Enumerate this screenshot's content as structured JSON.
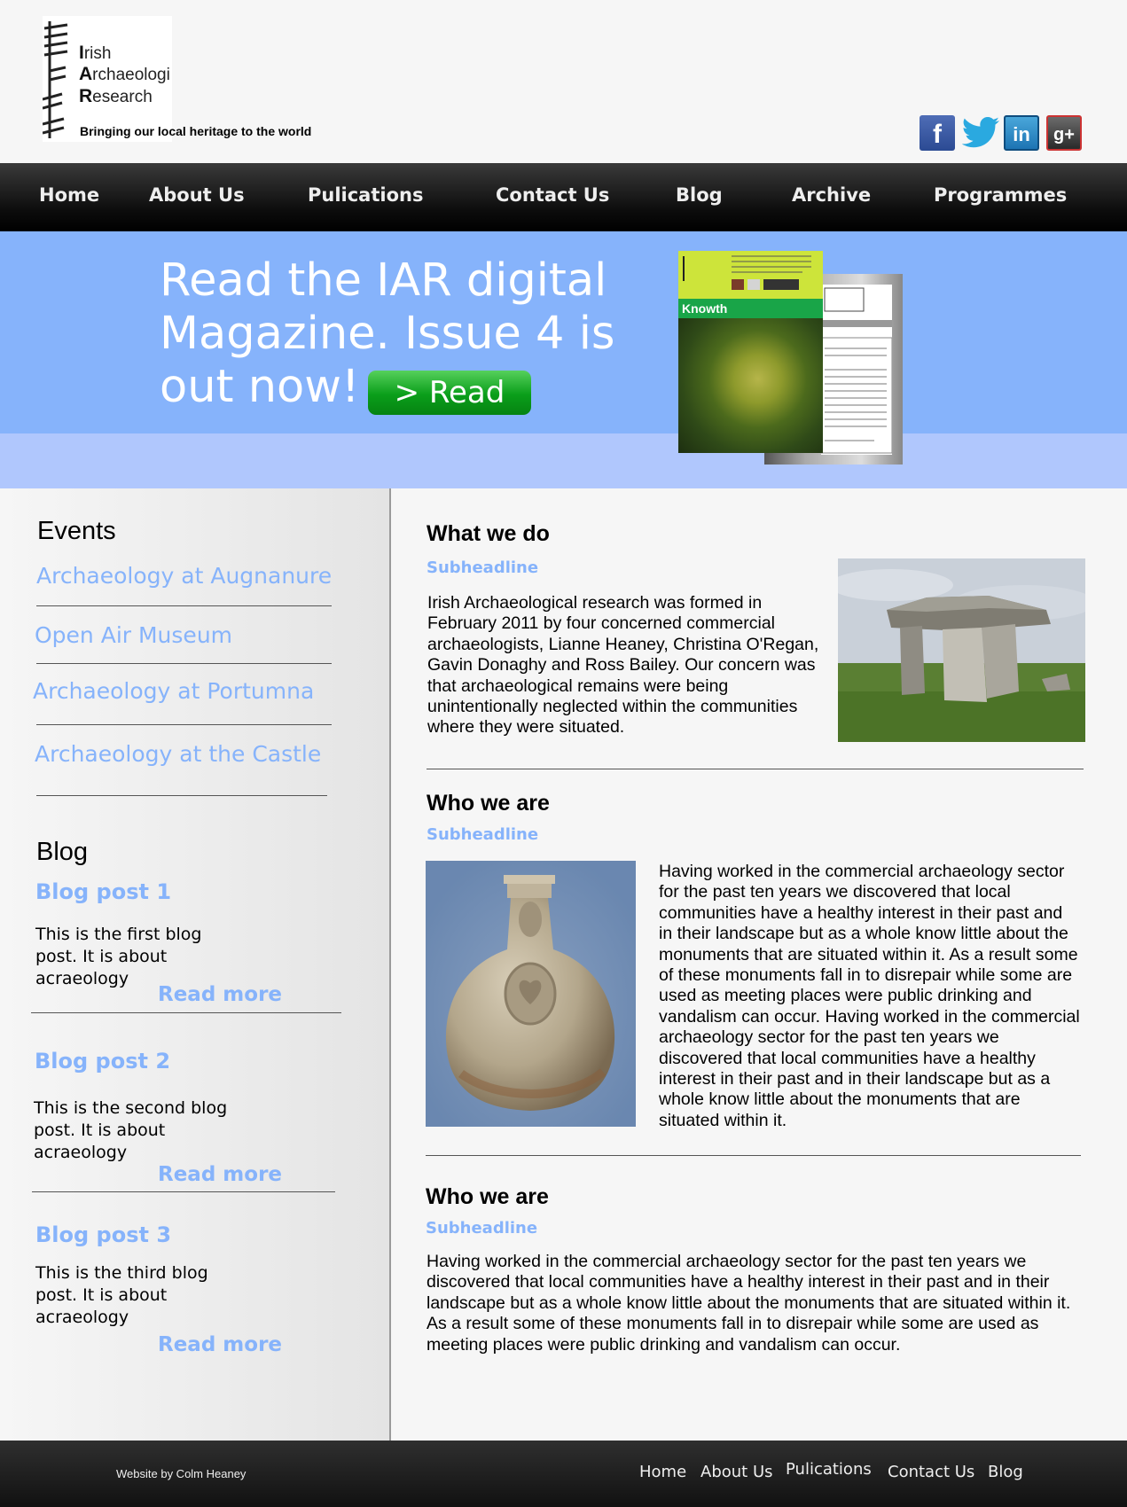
{
  "header": {
    "logo_lines": [
      {
        "initial": "I",
        "rest": "rish"
      },
      {
        "initial": "A",
        "rest": "rchaeologi"
      },
      {
        "initial": "R",
        "rest": "esearch"
      }
    ],
    "tagline": "Bringing our local heritage to the world",
    "social": [
      {
        "label": "f",
        "icon": "facebook-icon"
      },
      {
        "label": "",
        "icon": "twitter-icon"
      },
      {
        "label": "in",
        "icon": "linkedin-icon"
      },
      {
        "label": "g+",
        "icon": "google-plus-icon"
      }
    ]
  },
  "nav": {
    "items": [
      "Home",
      "About Us",
      "Pulications",
      "Contact Us",
      "Blog",
      "Archive",
      "Programmes"
    ]
  },
  "banner": {
    "line1": "Read the IAR digital",
    "line2": "Magazine. Issue 4 is",
    "line3": "out now!",
    "button": "> Read",
    "magazine_strip": "Knowth"
  },
  "sidebar": {
    "events_heading": "Events",
    "events": [
      "Archaeology at Augnanure",
      "Open Air Museum",
      "Archaeology at Portumna",
      "Archaeology at the Castle"
    ],
    "blog_heading": "Blog",
    "posts": [
      {
        "title": "Blog post 1",
        "body": "This is the first blog post. It is about acraeology",
        "more": "Read more"
      },
      {
        "title": "Blog post 2",
        "body": "This is the second blog post. It is about acraeology",
        "more": "Read more"
      },
      {
        "title": "Blog post 3",
        "body": "This is the third blog post. It is about acraeology",
        "more": "Read more"
      }
    ]
  },
  "main": {
    "sections": [
      {
        "heading": "What we do",
        "subheadline": "Subheadline",
        "text": "Irish Archaeological research was formed in February 2011 by four concerned commercial archaeologists, Lianne Heaney, Christina O'Regan, Gavin Donaghy and Ross Bailey. Our concern was that archaeological remains were being unintentionally neglected within the communities where they were situated."
      },
      {
        "heading": "Who we are",
        "subheadline": "Subheadline",
        "text": "Having worked in the commercial archaeology sector for the past ten years we discovered that local communities have a healthy interest in their past and in their landscape but as a whole know little about the monuments that are situated within it. As a result some of these monuments fall in to disrepair while some are used as meeting places were public drinking and vandalism can occur. Having worked in the commercial archaeology sector for the past ten years we discovered that local communities have a healthy interest in their past and in their landscape but as a whole know little about the monuments that are situated within it."
      },
      {
        "heading": "Who we are",
        "subheadline": "Subheadline",
        "text": "Having worked in the commercial archaeology sector for the past ten years we discovered that local communities have a healthy interest in their past and in their landscape but as a whole know little about the monuments that are situated within it. As a result some of these monuments fall in to disrepair while some are used as meeting places were public drinking and vandalism can occur."
      }
    ]
  },
  "footer": {
    "credit": "Website by Colm Heaney",
    "links": [
      "Home",
      "About Us",
      "Pulications",
      "Contact Us",
      "Blog"
    ]
  }
}
